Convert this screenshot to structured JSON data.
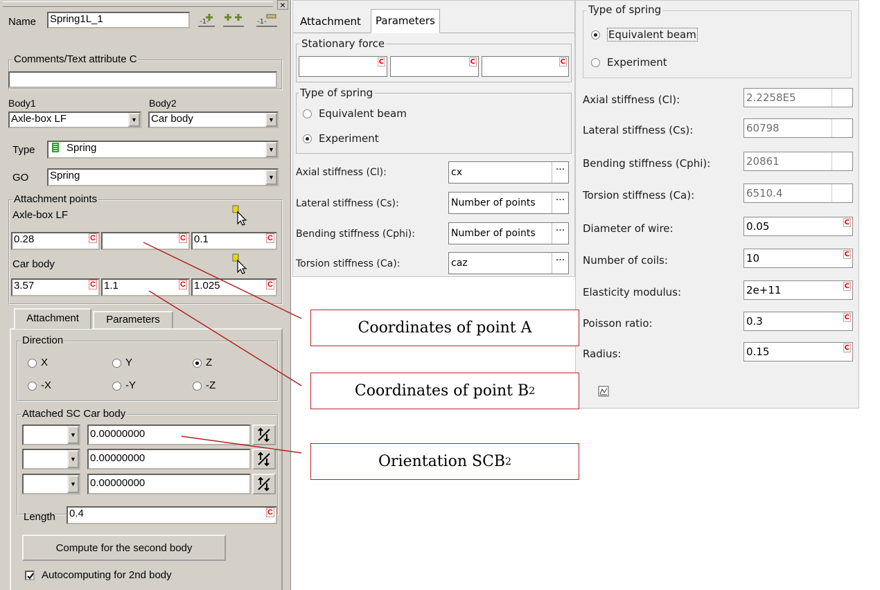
{
  "left_panel": {
    "name_label": "Name",
    "name_value": "Spring1L_1",
    "comments_title": "Comments/Text attribute C",
    "comments_value": "",
    "body1_label": "Body1",
    "body1_value": "Axle-box LF",
    "body2_label": "Body2",
    "body2_value": "Car body",
    "type_label": "Type",
    "type_value": "Spring",
    "go_label": "GO",
    "go_value": "Spring",
    "attach_title": "Attachment points",
    "point_a_label": "Axle-box LF",
    "point_a": [
      "0.28",
      "",
      "0.1"
    ],
    "point_b_label": "Car body",
    "point_b": [
      "3.57",
      "1.1",
      "1.025"
    ],
    "c_mark": "C",
    "tabs": [
      "Attachment",
      "Parameters"
    ],
    "direction_title": "Direction",
    "directions": [
      "X",
      "Y",
      "Z",
      "-X",
      "-Y",
      "-Z"
    ],
    "direction_selected": "Z",
    "attached_sc_title": "Attached SC Car body",
    "sc_values": [
      "0.00000000",
      "0.00000000",
      "0.00000000"
    ],
    "length_label": "Length",
    "length_value": "0.4",
    "compute_button": "Compute for the second body",
    "autocompute_label": "Autocomputing for 2nd body",
    "autocompute_checked": true,
    "close_symbol": "×"
  },
  "middle_panel": {
    "tabs": [
      "Attachment",
      "Parameters"
    ],
    "active_tab": "Parameters",
    "stationary_force_title": "Stationary force",
    "stationary_force_values": [
      "",
      "",
      ""
    ],
    "type_title": "Type of spring",
    "type_options": [
      "Equivalent beam",
      "Experiment"
    ],
    "type_selected": "Experiment",
    "rows": [
      {
        "label": "Axial stiffness (Cl):",
        "value": "cx"
      },
      {
        "label": "Lateral stiffness (Cs):",
        "value": "Number of points"
      },
      {
        "label": "Bending stiffness (Cphi):",
        "value": "Number of points"
      },
      {
        "label": "Torsion stiffness (Ca):",
        "value": "caz"
      }
    ],
    "dots": "···",
    "c_mark": "C"
  },
  "right_panel": {
    "type_title": "Type of spring",
    "type_options": [
      "Equivalent beam",
      "Experiment"
    ],
    "type_selected": "Equivalent beam",
    "readonly_rows": [
      {
        "label": "Axial stiffness (Cl):",
        "value": "2.2258E5"
      },
      {
        "label": "Lateral stiffness (Cs):",
        "value": "60798"
      },
      {
        "label": "Bending stiffness (Cphi):",
        "value": "20861"
      },
      {
        "label": "Torsion stiffness (Ca):",
        "value": "6510.4"
      }
    ],
    "input_rows": [
      {
        "label": "Diameter of wire:",
        "value": "0.05"
      },
      {
        "label": "Number of coils:",
        "value": "10"
      },
      {
        "label": "Elasticity modulus:",
        "value": "2e+11"
      },
      {
        "label": "Poisson ratio:",
        "value": "0.3"
      },
      {
        "label": "Radius:",
        "value": "0.15"
      }
    ],
    "c_mark": "C"
  },
  "callouts": {
    "point_a": "Coordinates of point A",
    "point_b_prefix": "Coordinates of point B",
    "point_b_sub": "2",
    "orientation_prefix": "Orientation SCB",
    "orientation_sub": "2"
  },
  "colors": {
    "classic_face": "#d4d0c8",
    "modern_face": "#f0f0f0",
    "callout_border": "#b22222",
    "leader_line": "#b22222",
    "c_mark": "#dd0000",
    "spring_icon": "#22aa22"
  }
}
